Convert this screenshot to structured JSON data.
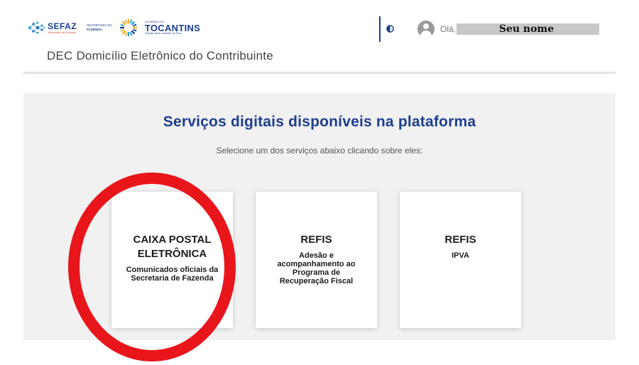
{
  "header": {
    "sefaz_logo": {
      "name": "SEFAZ",
      "tagline": "Secretaria da Fazenda"
    },
    "secretaria_logo": {
      "line1": "SECRETARIA DA",
      "line2": "FAZENDA"
    },
    "tocantins_logo": {
      "top": "GOVERNO DO",
      "name": "TOCANTINS",
      "tagline": "Trabalho atrai o trabalho do Povo"
    },
    "greeting": "Olá,",
    "user_name": "Seu nome",
    "app_title_abbr": "DEC",
    "app_title": "Domicílio Eletrônico do Contribuinte",
    "contrast_icon": "contrast-icon",
    "avatar_icon": "user-avatar-icon"
  },
  "main": {
    "title": "Serviços digitais disponíveis na plataforma",
    "subtitle": "Selecione um dos serviços abaixo clicando sobre eles:",
    "cards": [
      {
        "title": "CAIXA POSTAL ELETRÔNICA",
        "description": "Comunicados oficiais da Secretaria de Fazenda"
      },
      {
        "title": "REFIS",
        "description": "Adesão e acompanhamento ao Programa de Recuperação Fiscal"
      },
      {
        "title": "REFIS",
        "description": "IPVA"
      }
    ]
  },
  "colors": {
    "brand_blue": "#1d3f8f",
    "annotation_red": "#e8151b",
    "panel_background": "#f1f1f1"
  }
}
